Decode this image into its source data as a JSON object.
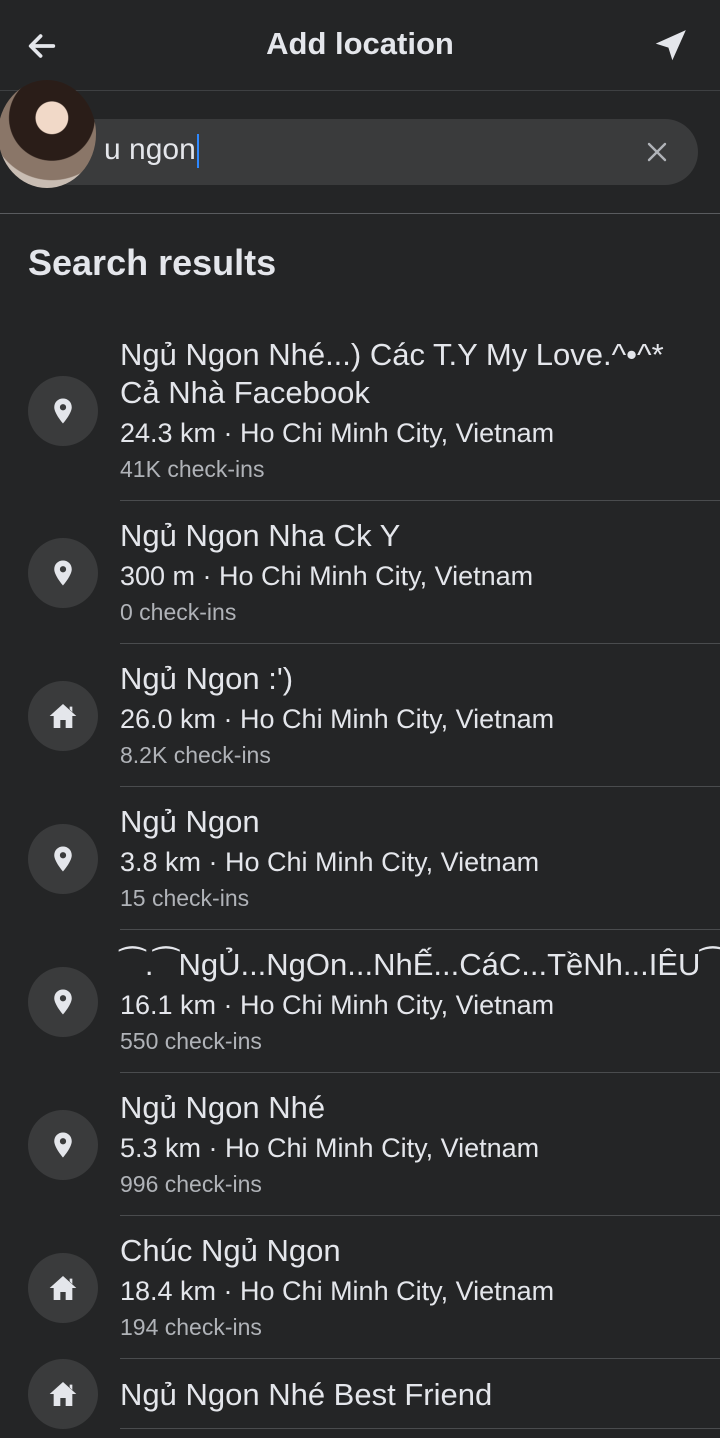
{
  "header": {
    "title": "Add location"
  },
  "search": {
    "value": "u ngon"
  },
  "section": {
    "title": "Search results"
  },
  "results": [
    {
      "name": "Ngủ Ngon Nhé...) Các T.Y My Love.^•^* Cả Nhà Facebook",
      "meta": "24.3 km · Ho Chi Minh City, Vietnam",
      "checkins": "41K check-ins",
      "icon": "pin"
    },
    {
      "name": "Ngủ Ngon Nha Ck Y",
      "meta": "300 m · Ho Chi Minh City, Vietnam",
      "checkins": "0 check-ins",
      "icon": "pin"
    },
    {
      "name": "Ngủ Ngon :')",
      "meta": "26.0 km · Ho Chi Minh City, Vietnam",
      "checkins": "8.2K check-ins",
      "icon": "home"
    },
    {
      "name": "Ngủ Ngon",
      "meta": "3.8 km · Ho Chi Minh City, Vietnam",
      "checkins": "15 check-ins",
      "icon": "pin"
    },
    {
      "name": "⁀.⁀NgỦ...NgOn...NhẾ...CáC...TềNh...IÊU⁀.⁀",
      "meta": "16.1 km · Ho Chi Minh City, Vietnam",
      "checkins": "550 check-ins",
      "icon": "pin"
    },
    {
      "name": "Ngủ Ngon Nhé",
      "meta": "5.3 km · Ho Chi Minh City, Vietnam",
      "checkins": "996 check-ins",
      "icon": "pin"
    },
    {
      "name": "Chúc Ngủ Ngon",
      "meta": "18.4 km · Ho Chi Minh City, Vietnam",
      "checkins": "194 check-ins",
      "icon": "home"
    },
    {
      "name": "Ngủ Ngon Nhé Best Friend",
      "meta": "",
      "checkins": "",
      "icon": "home"
    }
  ]
}
